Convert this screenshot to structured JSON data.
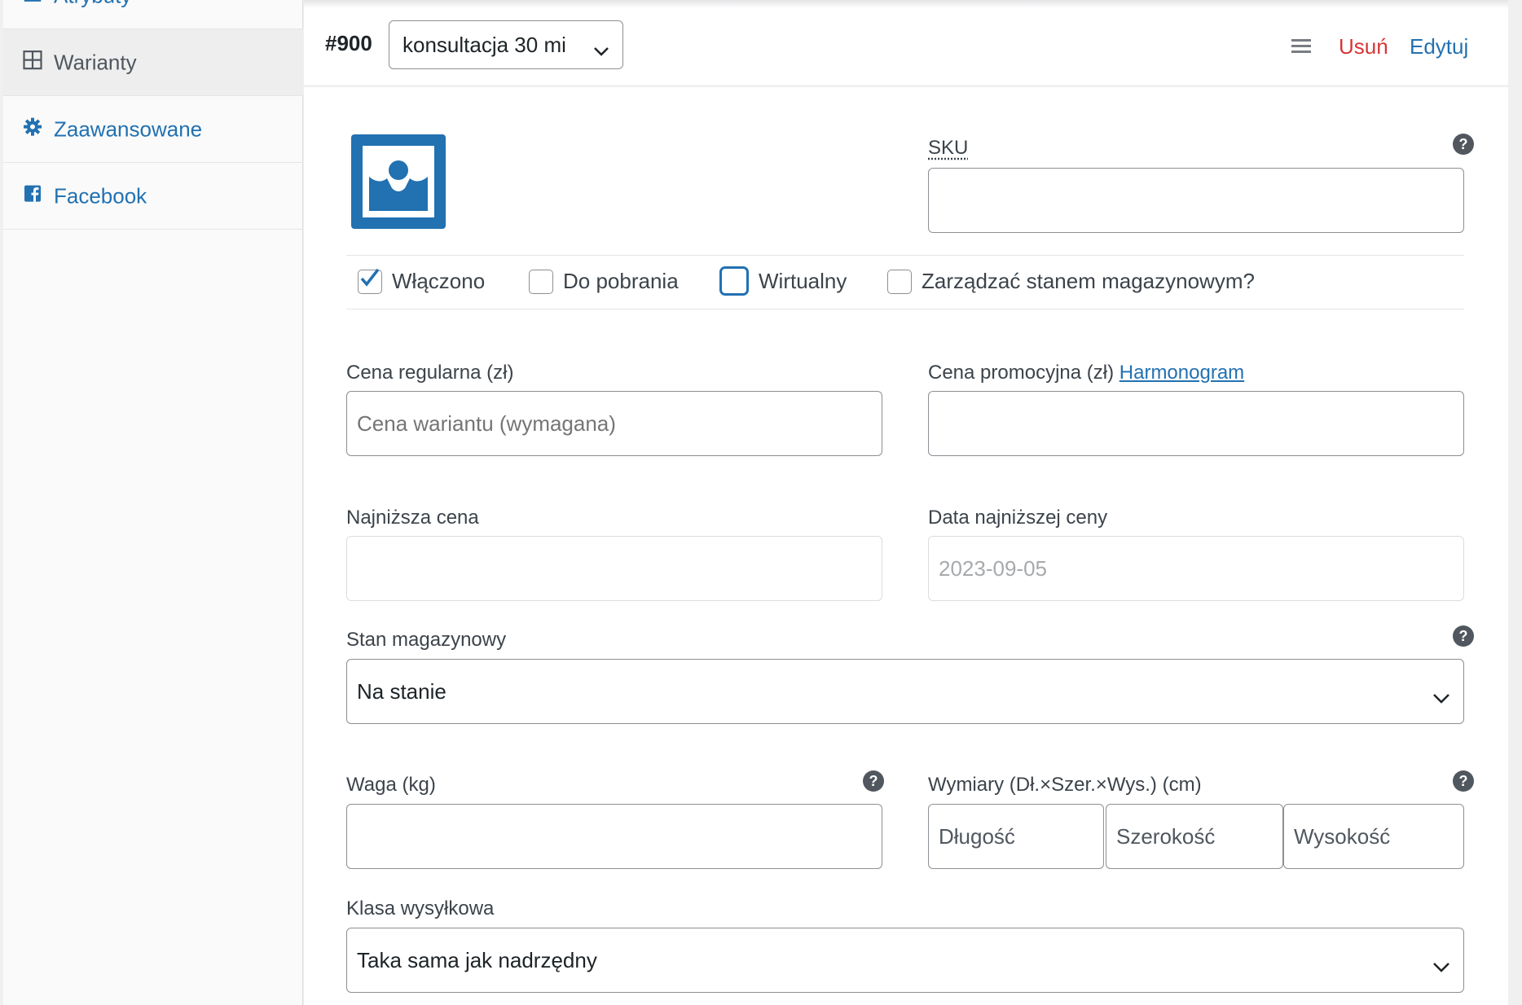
{
  "sidebar": {
    "items": [
      {
        "label": "Atrybuty"
      },
      {
        "label": "Warianty"
      },
      {
        "label": "Zaawansowane"
      },
      {
        "label": "Facebook"
      }
    ]
  },
  "variation": {
    "id": "#900",
    "attribute_value": "konsultacja 30 mi",
    "remove_label": "Usuń",
    "edit_label": "Edytuj"
  },
  "fields": {
    "sku_label": "SKU",
    "sku_value": "",
    "checkboxes": [
      {
        "label": "Włączono",
        "checked": true
      },
      {
        "label": "Do pobrania",
        "checked": false
      },
      {
        "label": "Wirtualny",
        "checked": false
      },
      {
        "label": "Zarządzać stanem magazynowym?",
        "checked": false
      }
    ],
    "regular_price_label": "Cena regularna (zł)",
    "regular_price_placeholder": "Cena wariantu (wymagana)",
    "sale_price_label": "Cena promocyjna (zł)",
    "schedule_link": "Harmonogram",
    "lowest_price_label": "Najniższa cena",
    "lowest_price_date_label": "Data najniższej ceny",
    "lowest_price_date_placeholder": "2023-09-05",
    "stock_status_label": "Stan magazynowy",
    "stock_status_value": "Na stanie",
    "weight_label": "Waga (kg)",
    "dimensions_label": "Wymiary (Dł.×Szer.×Wys.) (cm)",
    "length_placeholder": "Długość",
    "width_placeholder": "Szerokość",
    "height_placeholder": "Wysokość",
    "shipping_class_label": "Klasa wysyłkowa",
    "shipping_class_value": "Taka sama jak nadrzędny",
    "help_glyph": "?"
  },
  "colors": {
    "link": "#2271b1",
    "danger": "#d63638",
    "border": "#8c8f94"
  }
}
